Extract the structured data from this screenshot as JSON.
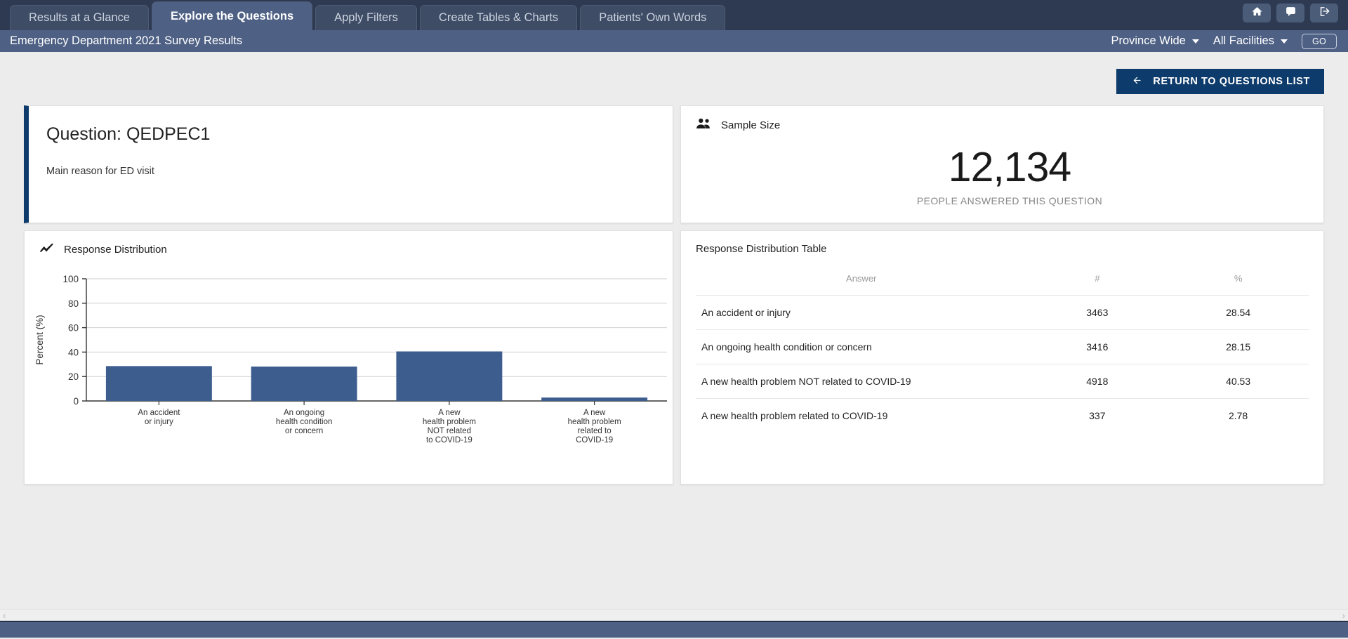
{
  "topbar": {
    "tabs": [
      {
        "label": "Results at a Glance",
        "active": false
      },
      {
        "label": "Explore the Questions",
        "active": true
      },
      {
        "label": "Apply Filters",
        "active": false
      },
      {
        "label": "Create Tables & Charts",
        "active": false
      },
      {
        "label": "Patients' Own Words",
        "active": false
      }
    ],
    "actions": [
      {
        "name": "home-icon",
        "label": "Home"
      },
      {
        "name": "comment-icon",
        "label": "Feedback"
      },
      {
        "name": "logout-icon",
        "label": "Sign out"
      }
    ]
  },
  "subbar": {
    "title": "Emergency Department 2021 Survey Results",
    "region_select": "Province Wide",
    "facility_select": "All Facilities",
    "go_label": "GO"
  },
  "actions": {
    "return_label": "RETURN TO QUESTIONS LIST"
  },
  "question_card": {
    "title": "Question: QEDPEC1",
    "subtitle": "Main reason for ED visit"
  },
  "sample_card": {
    "heading": "Sample Size",
    "value": "12,134",
    "caption": "PEOPLE ANSWERED THIS QUESTION"
  },
  "chart_card": {
    "heading": "Response Distribution"
  },
  "table_card": {
    "heading": "Response Distribution Table",
    "columns": [
      "Answer",
      "#",
      "%"
    ],
    "rows": [
      {
        "answer": "An accident or injury",
        "count": "3463",
        "percent": "28.54"
      },
      {
        "answer": "An ongoing health condition or concern",
        "count": "3416",
        "percent": "28.15"
      },
      {
        "answer": "A new health problem NOT related to COVID-19",
        "count": "4918",
        "percent": "40.53"
      },
      {
        "answer": "A new health problem related to COVID-19",
        "count": "337",
        "percent": "2.78"
      }
    ]
  },
  "scrollbar": {
    "left_chevron": "‹",
    "right_chevron": "›"
  },
  "colors": {
    "bar": "#3d5d8f",
    "accent": "#0d3b6b",
    "topbar": "#2e3a52",
    "subbar": "#4e6084",
    "tab_active": "#4e6084",
    "tab_inactive": "#3e4c66"
  },
  "chart_data": {
    "type": "bar",
    "title": "Response Distribution",
    "xlabel": "",
    "ylabel": "Percent (%)",
    "ylim": [
      0,
      100
    ],
    "yticks": [
      0,
      20,
      40,
      60,
      80,
      100
    ],
    "grid": true,
    "legend": "none",
    "categories": [
      "An accident\nor injury",
      "An ongoing\nhealth condition\nor concern",
      "A new\nhealth problem\nNOT related\nto COVID-19",
      "A new\nhealth problem\nrelated to\nCOVID-19"
    ],
    "values": [
      28.54,
      28.15,
      40.53,
      2.78
    ],
    "bar_color": "#3d5d8f"
  }
}
